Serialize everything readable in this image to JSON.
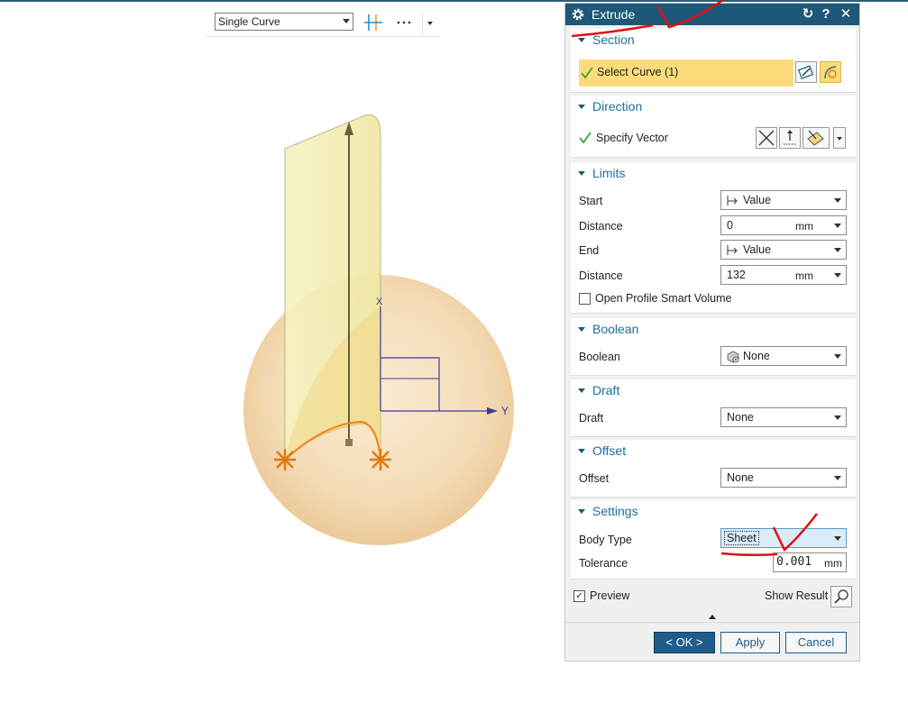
{
  "selection_toolbar": {
    "filter_value": "Single Curve",
    "icons": [
      "intersection-snap-icon",
      "more-options-icon"
    ]
  },
  "viewport": {
    "axis_label": "Y",
    "axis_label_z": "X"
  },
  "dialog": {
    "title": "Extrude",
    "title_buttons": [
      "reset-icon",
      "help-icon",
      "close-icon"
    ],
    "section": {
      "title": "Section",
      "select_curve_label": "Select Curve (1)"
    },
    "direction": {
      "title": "Direction",
      "specify_vector_label": "Specify Vector"
    },
    "limits": {
      "title": "Limits",
      "start_label": "Start",
      "start_value": "Value",
      "distance1_label": "Distance",
      "distance1_value": "0",
      "distance1_unit": "mm",
      "end_label": "End",
      "end_value": "Value",
      "distance2_label": "Distance",
      "distance2_value": "132",
      "distance2_unit": "mm",
      "open_profile_label": "Open Profile Smart Volume",
      "open_profile_checked": false
    },
    "boolean": {
      "title": "Boolean",
      "label": "Boolean",
      "value": "None"
    },
    "draft": {
      "title": "Draft",
      "label": "Draft",
      "value": "None"
    },
    "offset": {
      "title": "Offset",
      "label": "Offset",
      "value": "None"
    },
    "settings": {
      "title": "Settings",
      "body_type_label": "Body Type",
      "body_type_value": "Sheet",
      "tolerance_label": "Tolerance",
      "tolerance_value": "0.001",
      "tolerance_unit": "mm"
    },
    "preview": {
      "label": "Preview",
      "checked": true,
      "show_result_label": "Show Result"
    },
    "buttons": {
      "ok": "< OK >",
      "apply": "Apply",
      "cancel": "Cancel"
    }
  },
  "colors": {
    "titlebar": "#1e5777",
    "group_title": "#1e6e9a",
    "selection_highlight": "#fcdb7a",
    "check_green": "#3aa33a",
    "annotation_red": "#e01010",
    "sheet_yellow": "#f5f0b0",
    "sphere": "#f3d9b0",
    "curve_orange": "#f08a1c"
  }
}
